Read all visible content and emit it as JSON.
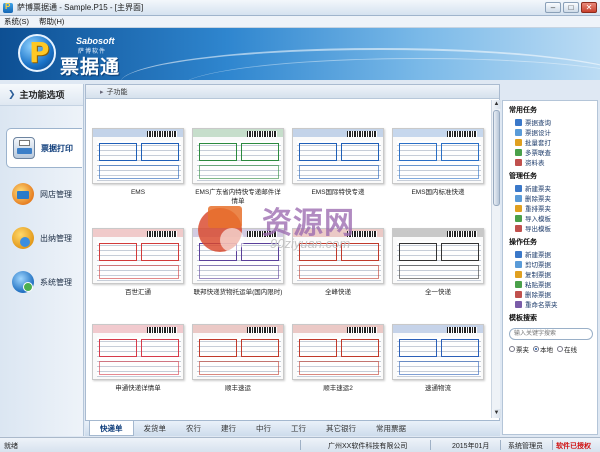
{
  "window": {
    "title": "萨博票据通 - Sample.P15 - [主界面]"
  },
  "menu": {
    "items": [
      "系统(S)",
      "帮助(H)"
    ]
  },
  "banner": {
    "brand_en": "Sabosoft",
    "brand_cn_small": "萨博软件",
    "product": "票据通"
  },
  "left": {
    "header": "主功能选项",
    "items": [
      {
        "label": "票据打印",
        "icon": "printer-icon",
        "active": true
      },
      {
        "label": "网店管理",
        "icon": "shop-icon",
        "active": false
      },
      {
        "label": "出纳管理",
        "icon": "cashier-icon",
        "active": false
      },
      {
        "label": "系统管理",
        "icon": "system-icon",
        "active": false
      }
    ]
  },
  "content": {
    "header": "子功能",
    "templates": [
      {
        "label": "EMS",
        "accent": "#1f5fb8"
      },
      {
        "label": "EMS广东省内特快专递邮件详情单",
        "accent": "#2b8a3e"
      },
      {
        "label": "EMS国际特快专递",
        "accent": "#1f5fb8"
      },
      {
        "label": "EMS国内标准快递",
        "accent": "#2a6fc6"
      },
      {
        "label": "百世汇通",
        "accent": "#d23a3a"
      },
      {
        "label": "联邦快递货物托运单(国内限时)",
        "accent": "#5a3f9a"
      },
      {
        "label": "全峰快递",
        "accent": "#c0392b"
      },
      {
        "label": "全一快递",
        "accent": "#333333"
      },
      {
        "label": "申通快递详情单",
        "accent": "#d63a4a"
      },
      {
        "label": "顺丰速运",
        "accent": "#c0392b"
      },
      {
        "label": "顺丰速运2",
        "accent": "#c0392b"
      },
      {
        "label": "速通物流",
        "accent": "#2b5fb8"
      }
    ]
  },
  "tabs": [
    {
      "label": "快递单",
      "active": true
    },
    {
      "label": "发货单",
      "active": false
    },
    {
      "label": "农行",
      "active": false
    },
    {
      "label": "建行",
      "active": false
    },
    {
      "label": "中行",
      "active": false
    },
    {
      "label": "工行",
      "active": false
    },
    {
      "label": "其它银行",
      "active": false
    },
    {
      "label": "常用票据",
      "active": false
    }
  ],
  "tasks": {
    "common_title": "常用任务",
    "common": [
      "票据查询",
      "票据设计",
      "批量套打",
      "多票联查",
      "资料表"
    ],
    "manage_title": "管理任务",
    "manage": [
      "新建票夹",
      "删除票夹",
      "重排票夹",
      "导入模板",
      "导出模板"
    ],
    "op_title": "操作任务",
    "op": [
      "新建票据",
      "剪切票据",
      "复制票据",
      "粘贴票据",
      "删除票据",
      "重命名票夹"
    ],
    "search_title": "模板搜索",
    "search_placeholder": "输入关键字搜索",
    "radios": [
      {
        "label": "票夹",
        "checked": false
      },
      {
        "label": "本地",
        "checked": true
      },
      {
        "label": "在线",
        "checked": false
      }
    ]
  },
  "status": {
    "ready": "就绪",
    "company": "广州XX软件科技有限公司",
    "date": "2015年01月",
    "user": "系统管理员",
    "license": "软件已授权",
    "license_color": "#d01010"
  },
  "watermark": {
    "text": "资源网",
    "url": "90ziyuan.com"
  }
}
